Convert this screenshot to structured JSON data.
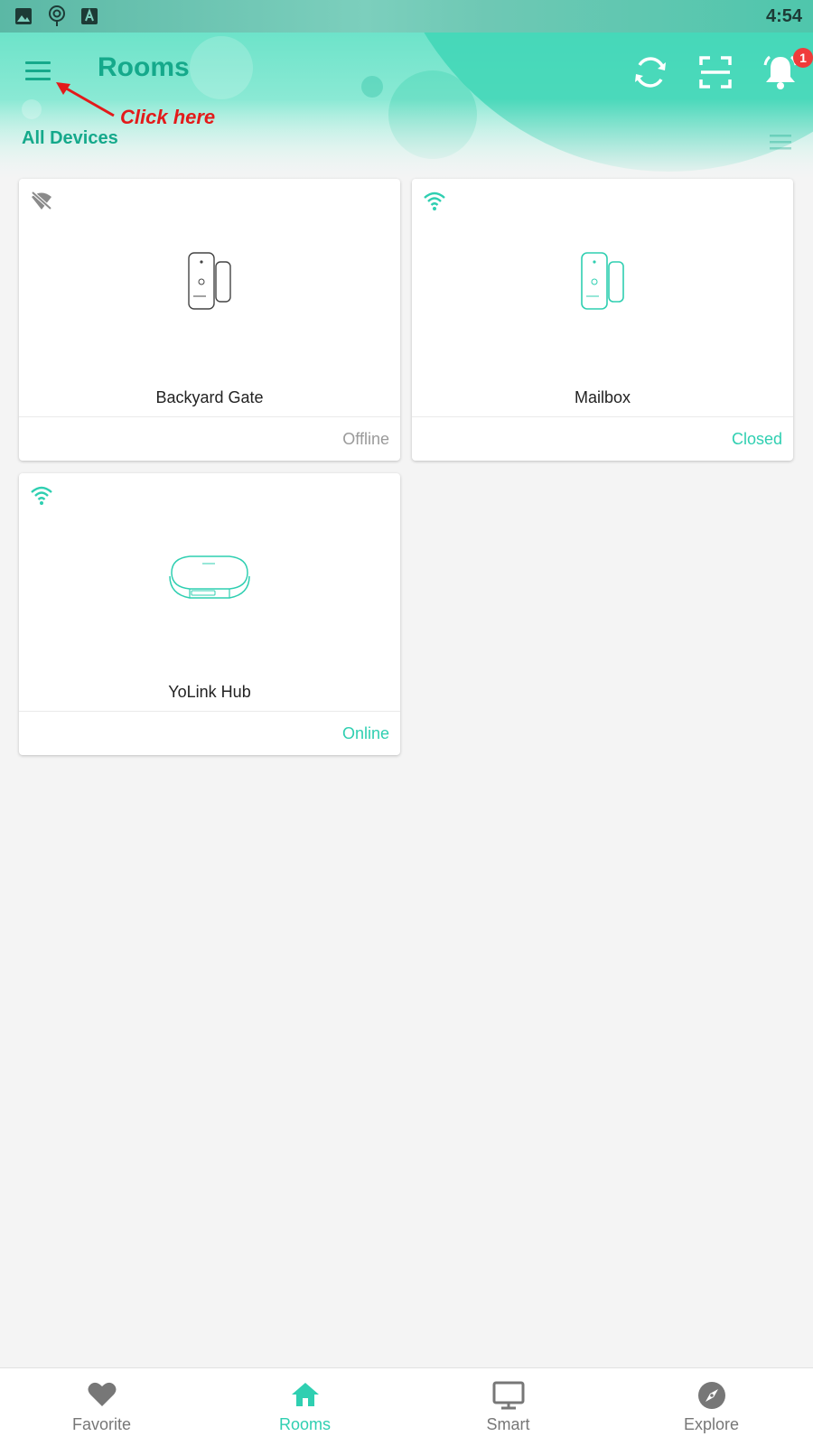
{
  "status_bar": {
    "time": "4:54",
    "icons": [
      "image-icon",
      "location-icon",
      "keyboard-a-icon"
    ]
  },
  "app_bar": {
    "title": "Rooms",
    "icons": [
      "menu-icon",
      "sync-icon",
      "scan-icon",
      "bell-icon"
    ],
    "notification_count": "1"
  },
  "annotation": {
    "text": "Click here",
    "color": "#e31a1a"
  },
  "section": {
    "label": "All Devices"
  },
  "devices": [
    {
      "name": "Backyard Gate",
      "status": "Offline",
      "connection_icon": "wifi-off-icon",
      "device_icon": "door-sensor-icon",
      "status_color": "#9a9a9a"
    },
    {
      "name": "Mailbox",
      "status": "Closed",
      "connection_icon": "wifi-icon",
      "device_icon": "door-sensor-icon",
      "status_color": "#2fcfb1"
    },
    {
      "name": "YoLink Hub",
      "status": "Online",
      "connection_icon": "wifi-icon",
      "device_icon": "hub-icon",
      "status_color": "#2fcfb1"
    }
  ],
  "bottom_nav": {
    "items": [
      {
        "label": "Favorite",
        "icon": "heart-icon"
      },
      {
        "label": "Rooms",
        "icon": "home-icon",
        "active": true
      },
      {
        "label": "Smart",
        "icon": "monitor-icon"
      },
      {
        "label": "Explore",
        "icon": "compass-icon"
      }
    ]
  },
  "colors": {
    "accent": "#2fcfb1",
    "title": "#15a98b",
    "badge": "#f03b3b",
    "background": "#f4f4f4"
  }
}
